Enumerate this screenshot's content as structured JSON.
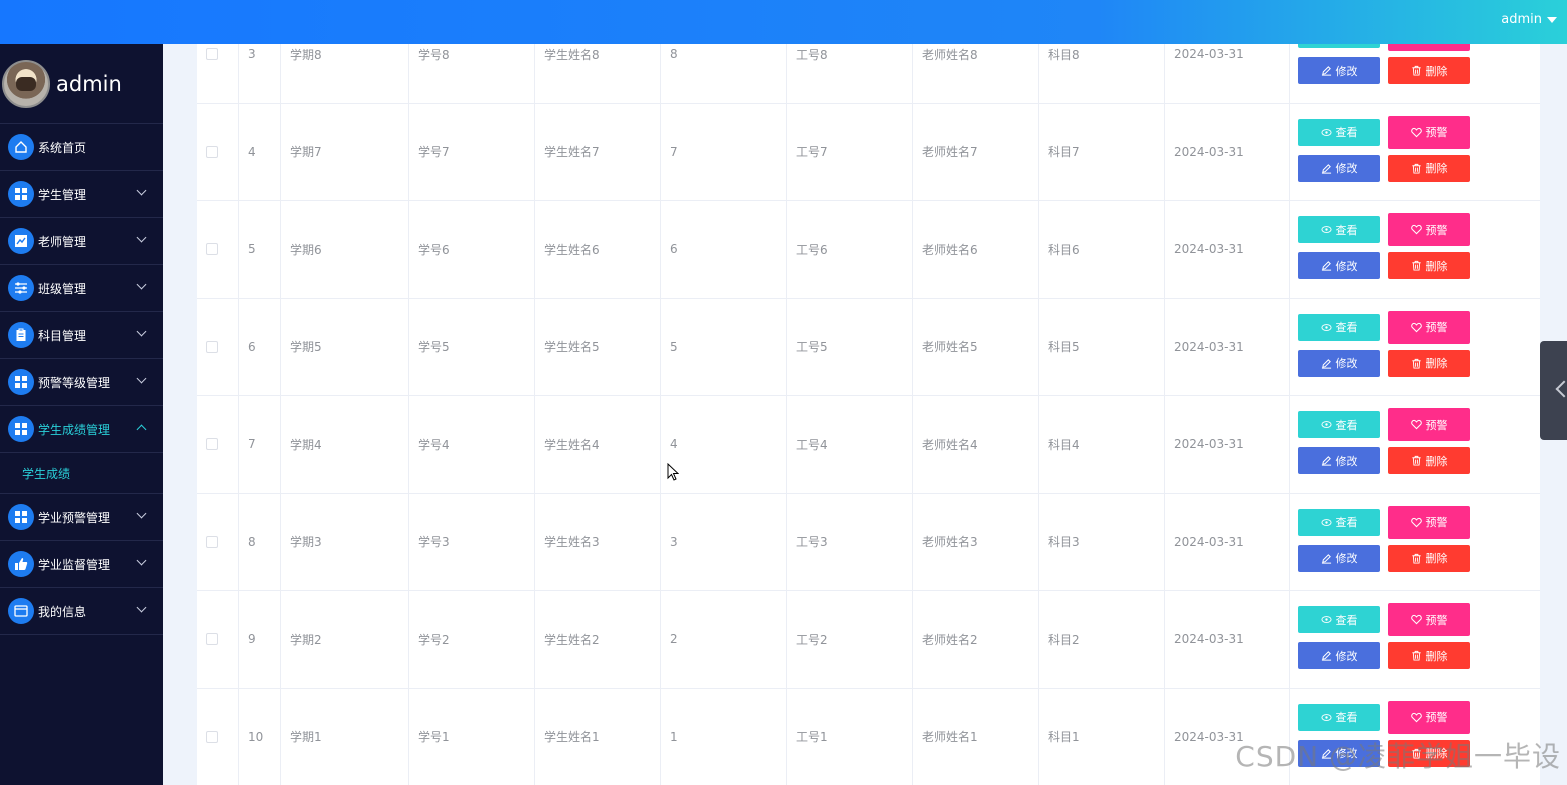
{
  "header": {
    "user": "admin"
  },
  "sidebar": {
    "username": "admin",
    "items": [
      {
        "label": "系统首页",
        "icon": "home-icon",
        "has_children": false,
        "active": false
      },
      {
        "label": "学生管理",
        "icon": "grid-icon",
        "has_children": true,
        "active": false
      },
      {
        "label": "老师管理",
        "icon": "chart-icon",
        "has_children": true,
        "active": false
      },
      {
        "label": "班级管理",
        "icon": "sliders-icon",
        "has_children": true,
        "active": false
      },
      {
        "label": "科目管理",
        "icon": "clipboard-icon",
        "has_children": true,
        "active": false
      },
      {
        "label": "预警等级管理",
        "icon": "grid-icon",
        "has_children": true,
        "active": false
      },
      {
        "label": "学生成绩管理",
        "icon": "grid-icon",
        "has_children": true,
        "active": true
      },
      {
        "label": "学业预警管理",
        "icon": "grid-icon",
        "has_children": true,
        "active": false
      },
      {
        "label": "学业监督管理",
        "icon": "thumb-icon",
        "has_children": true,
        "active": false
      },
      {
        "label": "我的信息",
        "icon": "card-icon",
        "has_children": true,
        "active": false
      }
    ],
    "subitem": "学生成绩"
  },
  "buttons": {
    "view": "查看",
    "warn": "预警",
    "edit": "修改",
    "delete": "删除"
  },
  "table": {
    "rows": [
      {
        "index": "3",
        "term": "学期8",
        "student_id": "学号8",
        "student_name": "学生姓名8",
        "score": "8",
        "teacher_id": "工号8",
        "teacher_name": "老师姓名8",
        "subject": "科目8",
        "date": "2024-03-31"
      },
      {
        "index": "4",
        "term": "学期7",
        "student_id": "学号7",
        "student_name": "学生姓名7",
        "score": "7",
        "teacher_id": "工号7",
        "teacher_name": "老师姓名7",
        "subject": "科目7",
        "date": "2024-03-31"
      },
      {
        "index": "5",
        "term": "学期6",
        "student_id": "学号6",
        "student_name": "学生姓名6",
        "score": "6",
        "teacher_id": "工号6",
        "teacher_name": "老师姓名6",
        "subject": "科目6",
        "date": "2024-03-31"
      },
      {
        "index": "6",
        "term": "学期5",
        "student_id": "学号5",
        "student_name": "学生姓名5",
        "score": "5",
        "teacher_id": "工号5",
        "teacher_name": "老师姓名5",
        "subject": "科目5",
        "date": "2024-03-31"
      },
      {
        "index": "7",
        "term": "学期4",
        "student_id": "学号4",
        "student_name": "学生姓名4",
        "score": "4",
        "teacher_id": "工号4",
        "teacher_name": "老师姓名4",
        "subject": "科目4",
        "date": "2024-03-31"
      },
      {
        "index": "8",
        "term": "学期3",
        "student_id": "学号3",
        "student_name": "学生姓名3",
        "score": "3",
        "teacher_id": "工号3",
        "teacher_name": "老师姓名3",
        "subject": "科目3",
        "date": "2024-03-31"
      },
      {
        "index": "9",
        "term": "学期2",
        "student_id": "学号2",
        "student_name": "学生姓名2",
        "score": "2",
        "teacher_id": "工号2",
        "teacher_name": "老师姓名2",
        "subject": "科目2",
        "date": "2024-03-31"
      },
      {
        "index": "10",
        "term": "学期1",
        "student_id": "学号1",
        "student_name": "学生姓名1",
        "score": "1",
        "teacher_id": "工号1",
        "teacher_name": "老师姓名1",
        "subject": "科目1",
        "date": "2024-03-31"
      }
    ]
  },
  "watermark": "CSDN @凌菲学姐一毕设"
}
